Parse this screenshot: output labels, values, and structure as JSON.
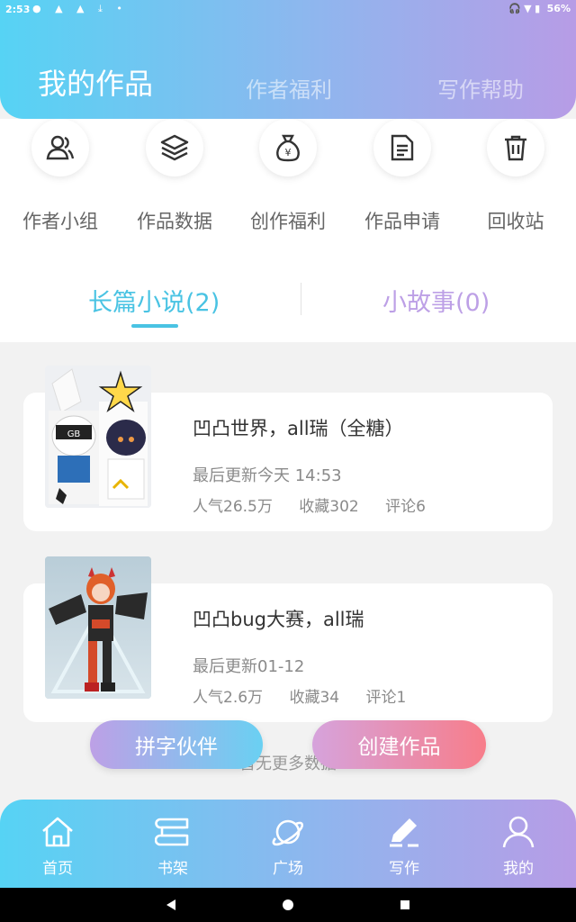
{
  "status_bar": {
    "time": "2:53",
    "left_icons": "● ▲ ▲ ⤓ •",
    "right_icons": "🎧 ▼ ▮",
    "battery": "56%"
  },
  "header": {
    "tabs": [
      {
        "label": "我的作品",
        "active": true
      },
      {
        "label": "作者福利",
        "active": false
      },
      {
        "label": "写作帮助",
        "active": false
      }
    ]
  },
  "quick_actions": [
    {
      "label": "作者小组",
      "icon": "group-icon"
    },
    {
      "label": "作品数据",
      "icon": "layers-icon"
    },
    {
      "label": "创作福利",
      "icon": "money-bag-icon"
    },
    {
      "label": "作品申请",
      "icon": "document-icon"
    },
    {
      "label": "回收站",
      "icon": "trash-icon"
    }
  ],
  "categories": [
    {
      "label": "长篇小说(2)",
      "active": true
    },
    {
      "label": "小故事(0)",
      "active": false
    }
  ],
  "works": [
    {
      "title": "凹凸世界，all瑞（全糖）",
      "updated": "最后更新今天 14:53",
      "popularity": "人气26.5万",
      "favorites": "收藏302",
      "comments": "评论6"
    },
    {
      "title": "凹凸bug大赛，all瑞",
      "updated": "最后更新01-12",
      "popularity": "人气2.6万",
      "favorites": "收藏34",
      "comments": "评论1"
    }
  ],
  "list_footer": "暂无更多数据",
  "floating_buttons": {
    "partner": "拼字伙伴",
    "create": "创建作品"
  },
  "bottom_nav": [
    {
      "label": "首页",
      "icon": "home-icon"
    },
    {
      "label": "书架",
      "icon": "bookshelf-icon"
    },
    {
      "label": "广场",
      "icon": "planet-icon"
    },
    {
      "label": "写作",
      "icon": "pen-icon"
    },
    {
      "label": "我的",
      "icon": "person-icon"
    }
  ],
  "colors": {
    "accent_blue": "#49c3e3",
    "accent_purple": "#bda0e6",
    "create_pink": "#f77d8a"
  }
}
